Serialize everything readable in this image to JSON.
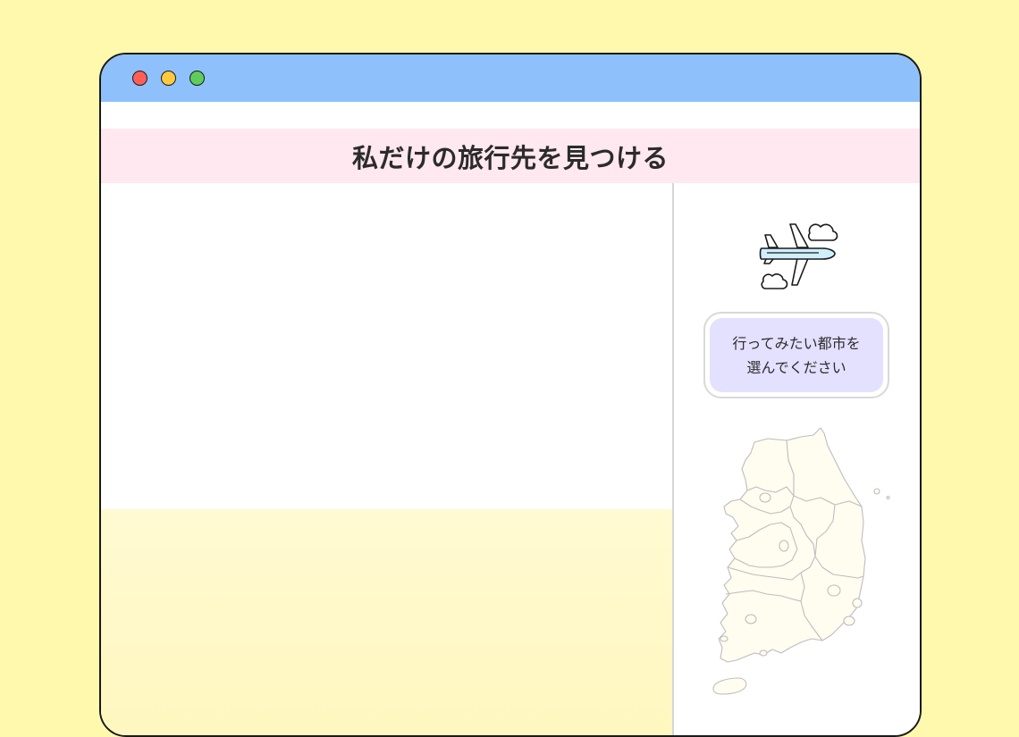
{
  "window": {
    "controls": [
      "close",
      "minimize",
      "maximize"
    ],
    "colors": {
      "background": "#fff9ad",
      "titlebar": "#8ec1fb",
      "banner": "#ffe8f0",
      "prompt": "#e4e0ff",
      "close": "#ff5f56",
      "minimize": "#ffc940",
      "maximize": "#5fcd5a"
    }
  },
  "header": {
    "title": "私だけの旅行先を見つける"
  },
  "sidebar": {
    "icon": "airplane-icon",
    "prompt_line1": "行ってみたい都市を",
    "prompt_line2": "選んでください",
    "map": "south-korea-map"
  }
}
